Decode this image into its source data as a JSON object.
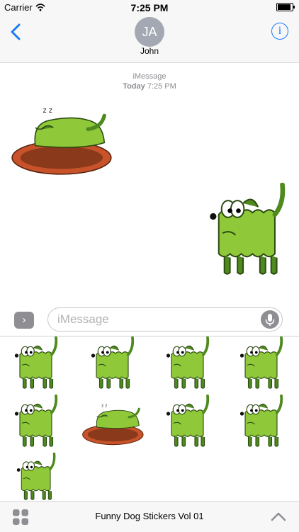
{
  "status_bar": {
    "carrier": "Carrier",
    "time": "7:25 PM"
  },
  "nav": {
    "avatar_initials": "JA",
    "contact_name": "John",
    "info_glyph": "i"
  },
  "conversation": {
    "service": "iMessage",
    "day": "Today",
    "time": "7:25 PM"
  },
  "input": {
    "apps_glyph": "›",
    "placeholder": "iMessage"
  },
  "tray": {
    "title": "Funny Dog Stickers Vol 01"
  },
  "icons": [
    "wifi-icon",
    "battery-icon",
    "back-chevron-icon",
    "info-icon",
    "apps-icon",
    "microphone-icon",
    "app-grid-icon",
    "chevron-up-icon"
  ],
  "colors": {
    "accent": "#1a7cf5",
    "dog_green": "#8fc93a",
    "rug": "#c8532a",
    "avatar": "#a3a8b2"
  },
  "stickers": {
    "sent_count": 2,
    "drawer_count": 9,
    "drawer_items": [
      "dog-standing",
      "dog-barking",
      "dog-spitting",
      "dog-glasses",
      "dog-puddle",
      "dog-sleeping-rug",
      "dog-yelling",
      "dog-worried",
      "dog-standing-small"
    ]
  }
}
